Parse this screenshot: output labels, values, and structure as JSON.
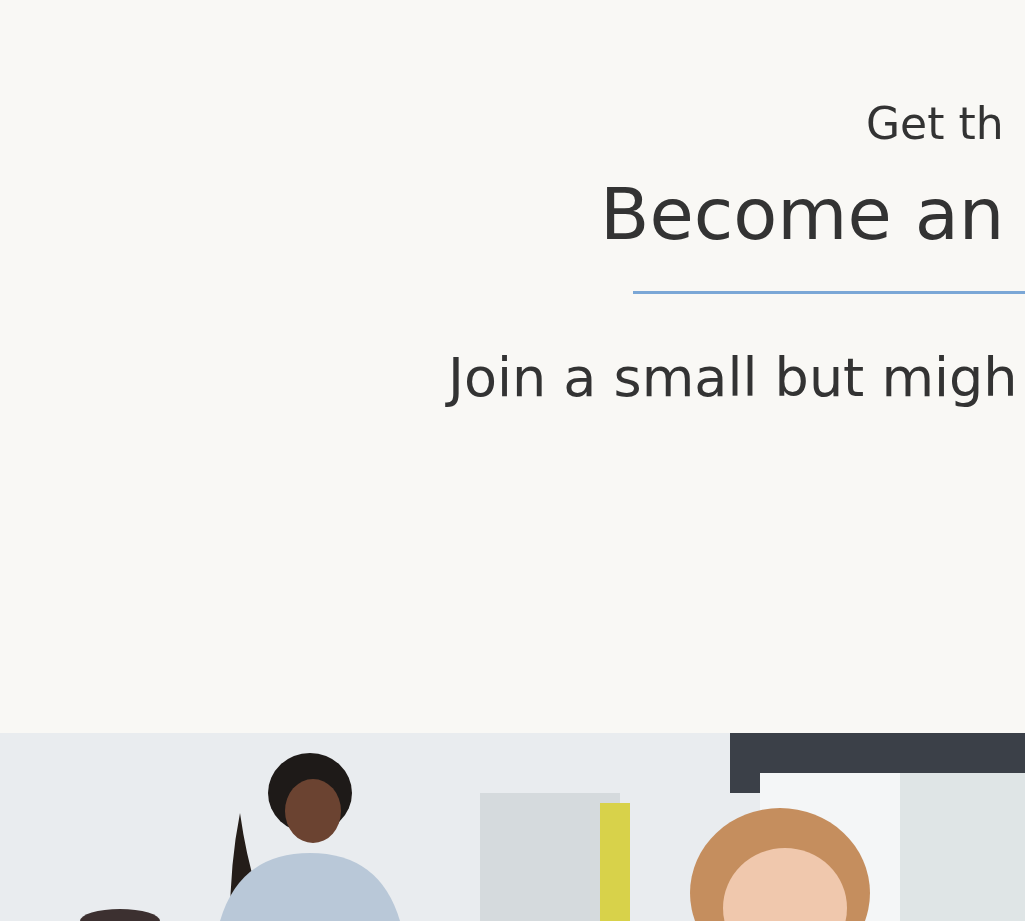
{
  "hero": {
    "eyebrow": "Get th",
    "title": "Become an",
    "subtitle": "Join a small but migh"
  }
}
